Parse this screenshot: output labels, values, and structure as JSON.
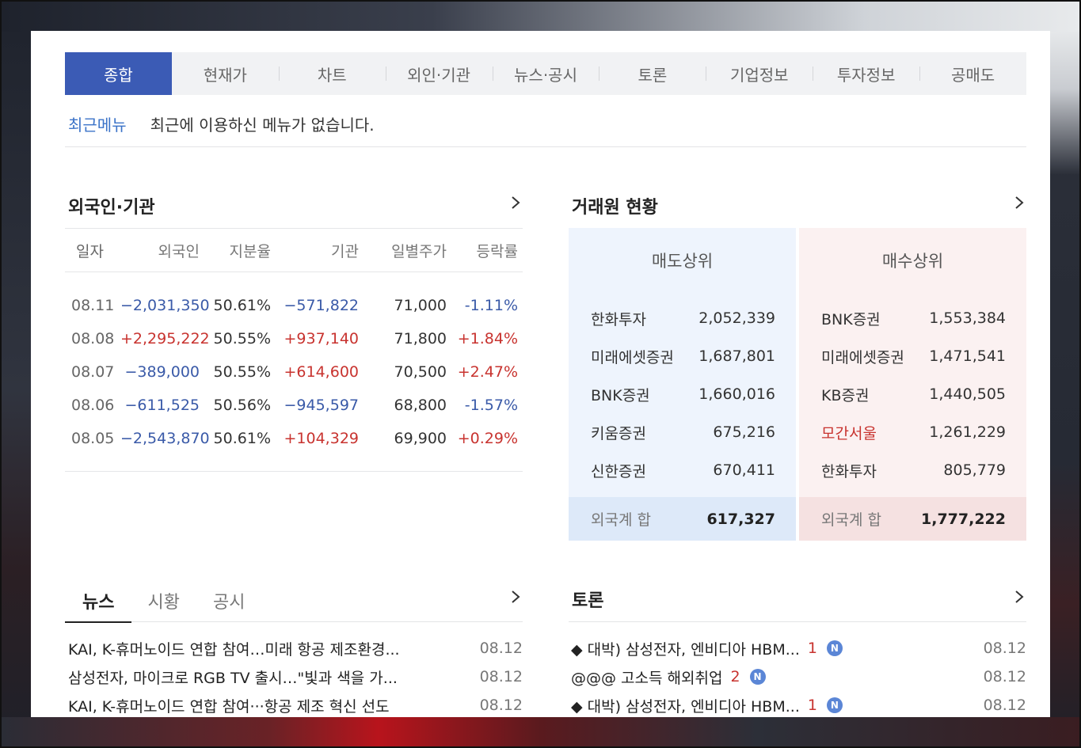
{
  "tabs": [
    "종합",
    "현재가",
    "차트",
    "외인·기관",
    "뉴스·공시",
    "토론",
    "기업정보",
    "투자정보",
    "공매도"
  ],
  "recent": {
    "label": "최근메뉴",
    "message": "최근에 이용하신 메뉴가 없습니다."
  },
  "foreign": {
    "title": "외국인·기관",
    "headers": [
      "일자",
      "외국인",
      "지분율",
      "기관",
      "일별주가",
      "등락률"
    ],
    "rows": [
      {
        "date": "08.11",
        "foreign": "−2,031,350",
        "ratio": "50.61%",
        "inst": "−571,822",
        "price": "71,000",
        "change": "-1.11%"
      },
      {
        "date": "08.08",
        "foreign": "+2,295,222",
        "ratio": "50.55%",
        "inst": "+937,140",
        "price": "71,800",
        "change": "+1.84%"
      },
      {
        "date": "08.07",
        "foreign": "−389,000",
        "ratio": "50.55%",
        "inst": "+614,600",
        "price": "70,500",
        "change": "+2.47%"
      },
      {
        "date": "08.06",
        "foreign": "−611,525",
        "ratio": "50.56%",
        "inst": "−945,597",
        "price": "68,800",
        "change": "-1.57%"
      },
      {
        "date": "08.05",
        "foreign": "−2,543,870",
        "ratio": "50.61%",
        "inst": "+104,329",
        "price": "69,900",
        "change": "+0.29%"
      }
    ]
  },
  "broker": {
    "title": "거래원 현황",
    "sell": {
      "header": "매도상위",
      "items": [
        {
          "name": "한화투자",
          "value": "2,052,339"
        },
        {
          "name": "미래에셋증권",
          "value": "1,687,801"
        },
        {
          "name": "BNK증권",
          "value": "1,660,016"
        },
        {
          "name": "키움증권",
          "value": "675,216"
        },
        {
          "name": "신한증권",
          "value": "670,411"
        }
      ],
      "total_label": "외국계 합",
      "total_value": "617,327"
    },
    "buy": {
      "header": "매수상위",
      "items": [
        {
          "name": "BNK증권",
          "value": "1,553,384"
        },
        {
          "name": "미래에셋증권",
          "value": "1,471,541"
        },
        {
          "name": "KB증권",
          "value": "1,440,505"
        },
        {
          "name": "모간서울",
          "value": "1,261,229"
        },
        {
          "name": "한화투자",
          "value": "805,779"
        }
      ],
      "total_label": "외국계 합",
      "total_value": "1,777,222"
    }
  },
  "news": {
    "tabs": [
      "뉴스",
      "시황",
      "공시"
    ],
    "items": [
      {
        "title": "KAI, K-휴머노이드 연합 참여…미래 항공 제조환경...",
        "date": "08.12"
      },
      {
        "title": "삼성전자, 마이크로 RGB TV 출시…\"빛과 색을 가...",
        "date": "08.12"
      },
      {
        "title": "KAI, K-휴머노이드 연합 참여···항공 제조 혁신 선도",
        "date": "08.12"
      }
    ]
  },
  "discussion": {
    "title": "토론",
    "items": [
      {
        "title": "◆ 대박) 삼성전자, 엔비디아 HBM...",
        "count": "1",
        "badge": "N",
        "date": "08.12"
      },
      {
        "title": "@@@ 고소득 해외취업",
        "count": "2",
        "badge": "N",
        "date": "08.12"
      },
      {
        "title": "◆ 대박) 삼성전자, 엔비디아 HBM...",
        "count": "1",
        "badge": "N",
        "date": "08.12"
      }
    ]
  },
  "colors": {
    "accent": "#3b5bb5",
    "negative": "#3a5aa8",
    "positive": "#c8332f",
    "sell_bg": "#eef4fd",
    "buy_bg": "#fbf1f1"
  }
}
